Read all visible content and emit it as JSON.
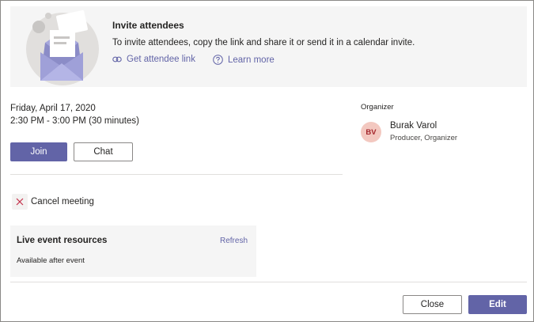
{
  "banner": {
    "title": "Invite attendees",
    "description": "To invite attendees, copy the link and share it or send it in a calendar invite.",
    "get_link_label": "Get attendee link",
    "learn_more_label": "Learn more"
  },
  "meeting": {
    "date": "Friday, April 17, 2020",
    "time": "2:30 PM - 3:00 PM (30 minutes)",
    "join_label": "Join",
    "chat_label": "Chat",
    "cancel_label": "Cancel meeting"
  },
  "resources": {
    "title": "Live event resources",
    "refresh_label": "Refresh",
    "subtitle": "Available after event"
  },
  "organizer": {
    "section_label": "Organizer",
    "initials": "BV",
    "name": "Burak Varol",
    "role": "Producer, Organizer"
  },
  "footer": {
    "close_label": "Close",
    "edit_label": "Edit"
  },
  "colors": {
    "accent": "#6264a7",
    "banner_bg": "#f5f5f5",
    "avatar_bg": "#f3c8c0",
    "avatar_text": "#a4262c",
    "cancel_icon": "#c4314b"
  },
  "icons": {
    "illustration": "envelope-invite-illustration",
    "link": "link-icon",
    "help": "question-circle-icon",
    "cancel": "close-x-icon"
  }
}
